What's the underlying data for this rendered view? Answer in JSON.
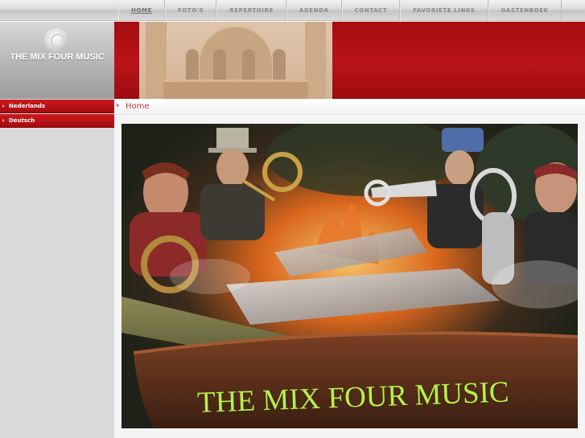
{
  "nav": {
    "items": [
      {
        "label": "HOME",
        "active": true
      },
      {
        "label": "FOTO'S",
        "active": false
      },
      {
        "label": "REPERTOIRE",
        "active": false
      },
      {
        "label": "AGENDA",
        "active": false
      },
      {
        "label": "CONTACT",
        "active": false
      },
      {
        "label": "FAVORIETE LINKS",
        "active": false
      },
      {
        "label": "GASTENBOEK",
        "active": false
      }
    ]
  },
  "header": {
    "site_title": "THE MIX FOUR MUSIC",
    "logo_icon": "disc-logo-icon",
    "accent_color": "#b21216"
  },
  "sidebar": {
    "languages": [
      {
        "label": "Nederlands"
      },
      {
        "label": "Deutsch"
      }
    ]
  },
  "main": {
    "breadcrumb_title": "Home",
    "hero_caption": "THE MIX FOUR MUSIC",
    "caption_color": "#b8ef4a"
  }
}
